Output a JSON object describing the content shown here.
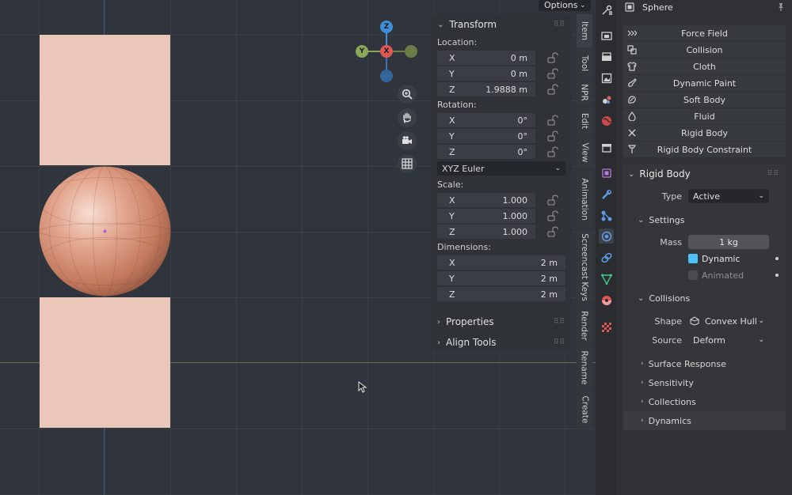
{
  "viewport": {
    "options_label": "Options",
    "gizmo": {
      "z": "Z",
      "y": "Y",
      "x": "X"
    }
  },
  "transform": {
    "title": "Transform",
    "location_label": "Location:",
    "location": [
      {
        "axis": "X",
        "value": "0 m"
      },
      {
        "axis": "Y",
        "value": "0 m"
      },
      {
        "axis": "Z",
        "value": "1.9888 m"
      }
    ],
    "rotation_label": "Rotation:",
    "rotation": [
      {
        "axis": "X",
        "value": "0°"
      },
      {
        "axis": "Y",
        "value": "0°"
      },
      {
        "axis": "Z",
        "value": "0°"
      }
    ],
    "rotation_mode": "XYZ Euler",
    "scale_label": "Scale:",
    "scale": [
      {
        "axis": "X",
        "value": "1.000"
      },
      {
        "axis": "Y",
        "value": "1.000"
      },
      {
        "axis": "Z",
        "value": "1.000"
      }
    ],
    "dimensions_label": "Dimensions:",
    "dimensions": [
      {
        "axis": "X",
        "value": "2 m"
      },
      {
        "axis": "Y",
        "value": "2 m"
      },
      {
        "axis": "Z",
        "value": "2 m"
      }
    ],
    "properties_label": "Properties",
    "align_tools_label": "Align Tools"
  },
  "tabs": [
    "Item",
    "Tool",
    "NPR",
    "Edit",
    "View",
    "Animation",
    "Screencast Keys",
    "Render",
    "Rename",
    "Create"
  ],
  "properties": {
    "object_name": "Sphere",
    "physics_buttons": [
      "Force Field",
      "Collision",
      "Cloth",
      "Dynamic Paint",
      "Soft Body",
      "Fluid",
      "Rigid Body",
      "Rigid Body Constraint"
    ],
    "rigid_body": {
      "title": "Rigid Body",
      "type_label": "Type",
      "type_value": "Active",
      "settings_label": "Settings",
      "mass_label": "Mass",
      "mass_value": "1 kg",
      "dynamic_label": "Dynamic",
      "animated_label": "Animated",
      "collisions_label": "Collisions",
      "shape_label": "Shape",
      "shape_value": "Convex Hull",
      "source_label": "Source",
      "source_value": "Deform",
      "subpanels": [
        "Surface Response",
        "Sensitivity",
        "Collections",
        "Dynamics"
      ]
    }
  },
  "colors": {
    "accent_checkbox": "#4fc3f7",
    "cube": "#eac7b8",
    "gizmo_x": "#e05757",
    "gizmo_y": "#8aa85a",
    "gizmo_z": "#3f8fd8"
  }
}
